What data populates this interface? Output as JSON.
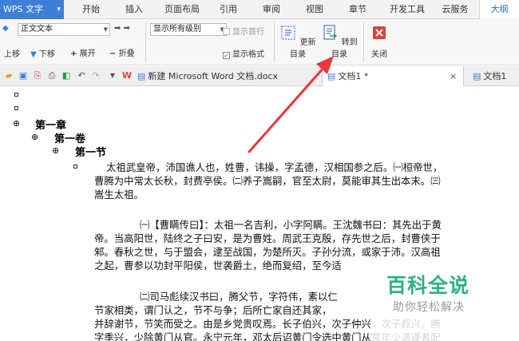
{
  "menubar": {
    "app_label": "WPS 文字",
    "tabs": [
      "开始",
      "插入",
      "页面布局",
      "引用",
      "审阅",
      "视图",
      "章节",
      "开发工具",
      "云服务",
      "大纲"
    ],
    "active_tab": "大纲"
  },
  "ribbon": {
    "left_arrow": "◆",
    "body_text_combo": "正文文本",
    "promote_arrows": "➡ ➡",
    "show_level_combo": "显示所有级别",
    "show_first_line": "显示首行",
    "show_format": "显示格式",
    "move_up": "上移",
    "move_down": "下移",
    "expand": "展开",
    "collapse": "折叠",
    "update_toc": "更新目录",
    "goto_toc": "转到目录",
    "close": "关闭"
  },
  "doc_tabs": {
    "tabs": [
      {
        "label": "新建 Microsoft Word 文档.docx",
        "current": false
      },
      {
        "label": "文档1 *",
        "current": true
      },
      {
        "label": "文档1",
        "current": false
      }
    ]
  },
  "document": {
    "heading1": "第一章",
    "heading2": "第一卷",
    "heading3": "第一节",
    "p1": [
      "太祖武皇帝，沛国谯人也，姓曹，讳操，字孟德，汉相国参之后。㈠桓帝世，",
      "曹腾为中常太长秋，封费亭侯。㈡养子嵩嗣，官至太尉，莫能审其生出本末。㈢",
      "嵩生太祖。"
    ],
    "p2": [
      "㈠【曹瞒传曰】：太祖一名吉利，小字阿瞒。王沈魏书曰：其先出于黄",
      "帝。当高阳世，陆终之子曰安，是为曹姓。周武王克殷，存先世之后，封曹侠于",
      "邾。春秋之世，与于盟会，逮至战国，为楚所灭。子孙分流，或家于沛。汉高祖",
      "之起，曹参以功封平阳侯，世袭爵土，绝而复绍，至今适"
    ],
    "p3": [
      "㈡司马彪续汉书曰，腾父节，字符伟，素以仁",
      "节家相类，谓门认之，节不与争；后所亡家自还其家，",
      "并辞谢节，节笑而受之。由是乡党贵叹焉。长子伯兴，次子仲兴，次子叔兴。腾",
      "字季兴，少除黄门从官。永宁元年，邓太后诏黄门令选中黄门从官年少温谨者配"
    ]
  },
  "watermark": {
    "title": "百科全说",
    "subtitle": "助你轻松解决"
  },
  "colors": {
    "accent": "#3d7fd8",
    "annotation_arrow": "#e8383d",
    "watermark": "#2fb27c"
  }
}
